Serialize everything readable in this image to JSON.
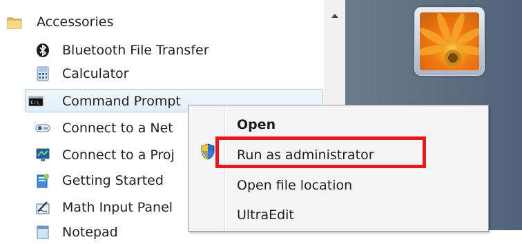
{
  "program_list": {
    "items": [
      {
        "label": "Accessories",
        "icon": "folder-icon"
      },
      {
        "label": "Bluetooth File Transfer",
        "icon": "bluetooth-icon"
      },
      {
        "label": "Calculator",
        "icon": "calculator-icon"
      },
      {
        "label": "Command Prompt",
        "icon": "command-prompt-icon"
      },
      {
        "label": "Connect to a Net",
        "icon": "network-projector-icon"
      },
      {
        "label": "Connect to a Proj",
        "icon": "projector-icon"
      },
      {
        "label": "Getting Started",
        "icon": "getting-started-icon"
      },
      {
        "label": "Math Input Panel",
        "icon": "math-input-icon"
      },
      {
        "label": "Notepad",
        "icon": "notepad-icon"
      }
    ]
  },
  "context_menu": {
    "items": [
      {
        "label": "Open",
        "bold": true
      },
      {
        "label": "Run as administrator",
        "icon": "uac-shield-icon",
        "highlighted_by": "red-rectangle"
      },
      {
        "label": "Open file location"
      },
      {
        "label": "UltraEdit"
      }
    ]
  },
  "colors": {
    "highlight_box": "#e5181f",
    "selection": "#e2effc",
    "right_pane": "#5e6d80"
  }
}
